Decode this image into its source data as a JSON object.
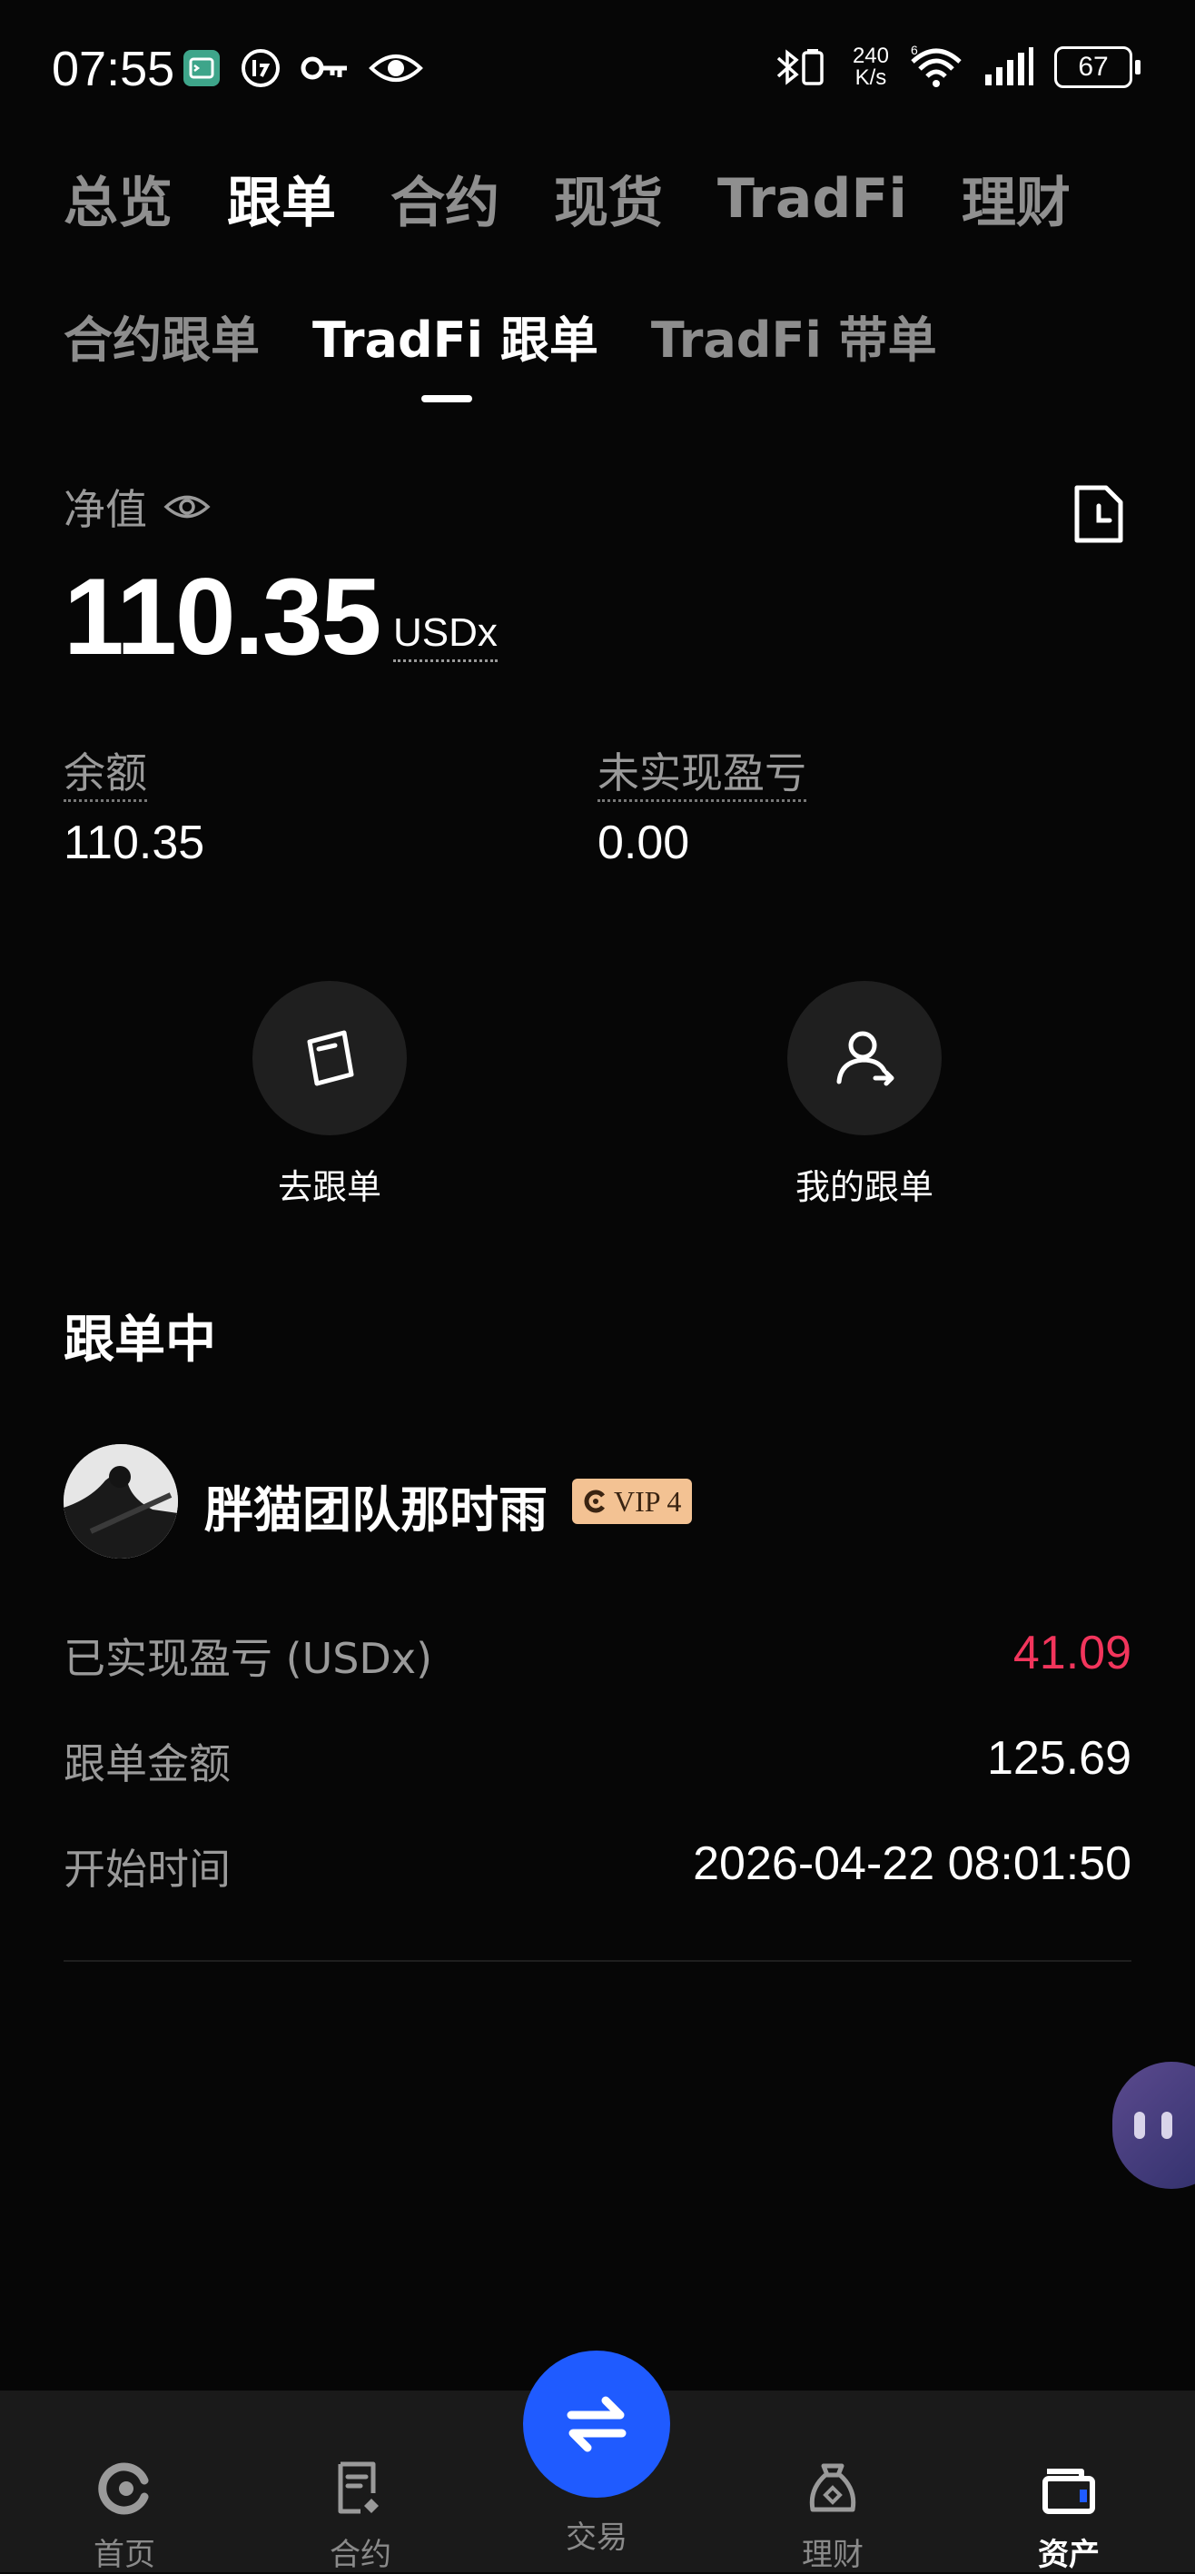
{
  "status_bar": {
    "time": "07:55",
    "net_speed_value": "240",
    "net_speed_unit": "K/s",
    "battery": "67",
    "icons_left": [
      "terminal-app-icon",
      "notification-badge-icon",
      "key-icon",
      "eye-icon"
    ],
    "icons_right": [
      "bluetooth-icon",
      "network-speed",
      "wifi-icon",
      "signal-icon",
      "battery-icon"
    ]
  },
  "top_tabs": [
    {
      "label": "总览",
      "active": false
    },
    {
      "label": "跟单",
      "active": true
    },
    {
      "label": "合约",
      "active": false
    },
    {
      "label": "现货",
      "active": false
    },
    {
      "label": "TradFi",
      "active": false
    },
    {
      "label": "理财",
      "active": false
    }
  ],
  "sub_tabs": [
    {
      "label": "合约跟单",
      "active": false
    },
    {
      "label": "TradFi 跟单",
      "active": true
    },
    {
      "label": "TradFi 带单",
      "active": false
    }
  ],
  "equity": {
    "label": "净值",
    "value": "110.35",
    "unit": "USDx"
  },
  "stats": {
    "balance_label": "余额",
    "balance_value": "110.35",
    "unrealized_label": "未实现盈亏",
    "unrealized_value": "0.00"
  },
  "actions": {
    "go_copy_label": "去跟单",
    "my_copy_label": "我的跟单"
  },
  "section": {
    "title": "跟单中"
  },
  "trader": {
    "name": "胖猫团队那时雨",
    "vip_label": "VIP 4",
    "realized_pnl_label": "已实现盈亏 (USDx)",
    "realized_pnl_value": "41.09",
    "copy_amount_label": "跟单金额",
    "copy_amount_value": "125.69",
    "start_time_label": "开始时间",
    "start_time_value": "2026-04-22 08:01:50"
  },
  "colors": {
    "background": "#060606",
    "positive_pnl": "#f2355c",
    "accent_blue": "#1f5bff",
    "vip_badge": "#f3c293"
  },
  "bottom_nav": [
    {
      "label": "首页",
      "icon": "home-icon",
      "active": false
    },
    {
      "label": "合约",
      "icon": "contract-icon",
      "active": false
    },
    {
      "label": "交易",
      "icon": "swap-icon",
      "active": false
    },
    {
      "label": "理财",
      "icon": "finance-icon",
      "active": false
    },
    {
      "label": "资产",
      "icon": "wallet-icon",
      "active": true
    }
  ]
}
